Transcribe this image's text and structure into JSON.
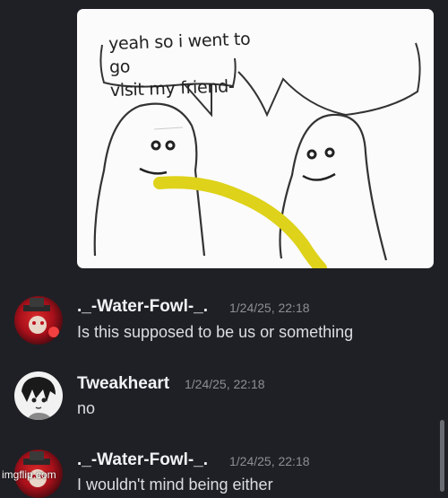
{
  "meme": {
    "caption_line1": "yeah so i went to go",
    "caption_line2": "visit my friend-"
  },
  "messages": [
    {
      "author": "._-Water-Fowl-_.",
      "timestamp": "1/24/25, 22:18",
      "text": "Is this supposed to be us or something",
      "avatar": "red-hat-avatar"
    },
    {
      "author": "Tweakheart",
      "timestamp": "1/24/25, 22:18",
      "text": "no",
      "avatar": "dark-hair-avatar"
    },
    {
      "author": "._-Water-Fowl-_.",
      "timestamp": "1/24/25, 22:18",
      "text": "I wouldn't mind being either",
      "avatar": "red-hat-avatar"
    }
  ],
  "watermark": "imgflip.com",
  "colors": {
    "background": "#1f2025",
    "username": "#f2f3f5",
    "message_text": "#dbdee1",
    "timestamp": "#8d8f95"
  }
}
